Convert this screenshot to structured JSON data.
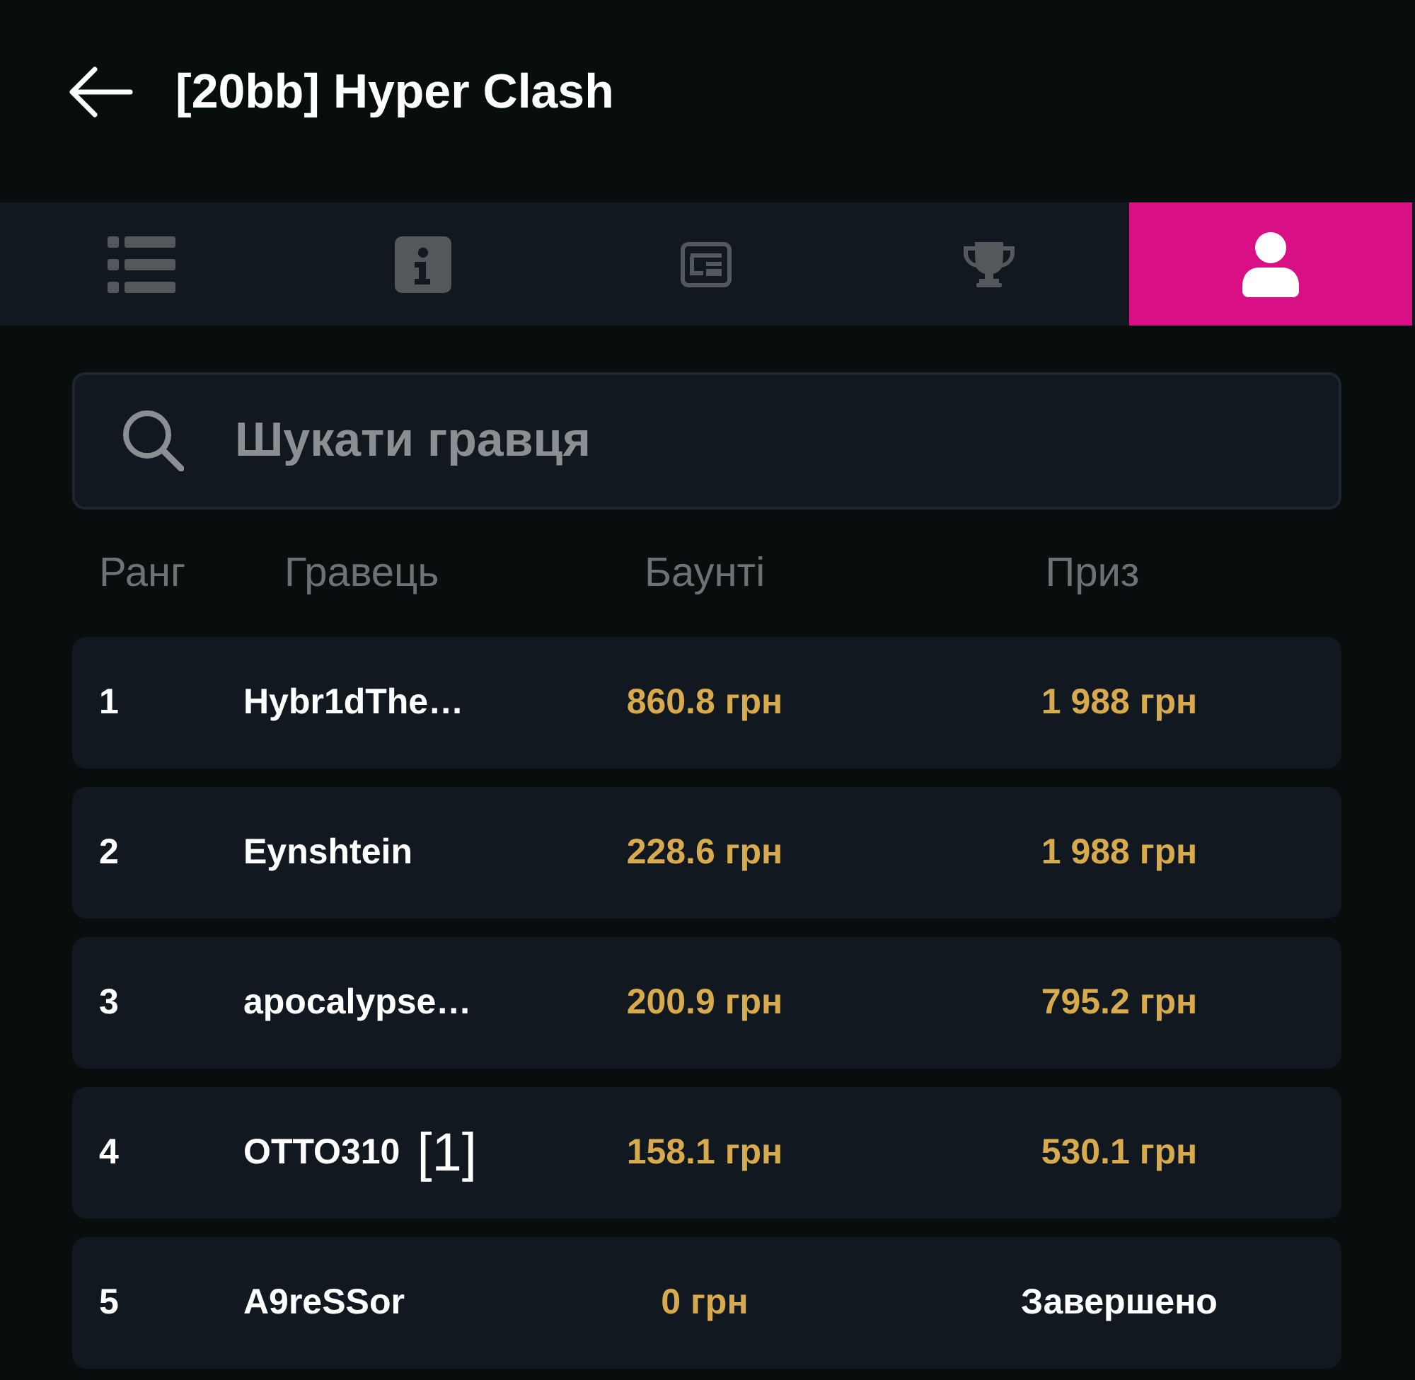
{
  "header": {
    "title": "[20bb] Hyper Clash"
  },
  "tabs": [
    {
      "selected": false
    },
    {
      "selected": false
    },
    {
      "selected": false
    },
    {
      "selected": false
    },
    {
      "selected": true
    }
  ],
  "search": {
    "placeholder": "Шукати гравця"
  },
  "table": {
    "columns": [
      "Ранг",
      "Гравець",
      "Баунті",
      "Приз"
    ],
    "rows": [
      {
        "kind": "paid",
        "rank": "1",
        "player": "Hybr1dThe…",
        "bounty": "860.8 грн",
        "prize": "1 988 грн"
      },
      {
        "kind": "paid",
        "rank": "2",
        "player": "Eynshtein",
        "bounty": "228.6 грн",
        "prize": "1 988 грн"
      },
      {
        "kind": "paid",
        "rank": "3",
        "player": "apocalypse…",
        "bounty": "200.9 грн",
        "prize": "795.2 грн"
      },
      {
        "kind": "paid",
        "rank": "4",
        "player": "OTTO310",
        "tag": "[1]",
        "bounty": "158.1 грн",
        "prize": "530.1 грн"
      },
      {
        "kind": "finished",
        "rank": "5",
        "player": "A9reSSor",
        "bounty": "0 грн",
        "prize": "Завершено"
      }
    ]
  }
}
